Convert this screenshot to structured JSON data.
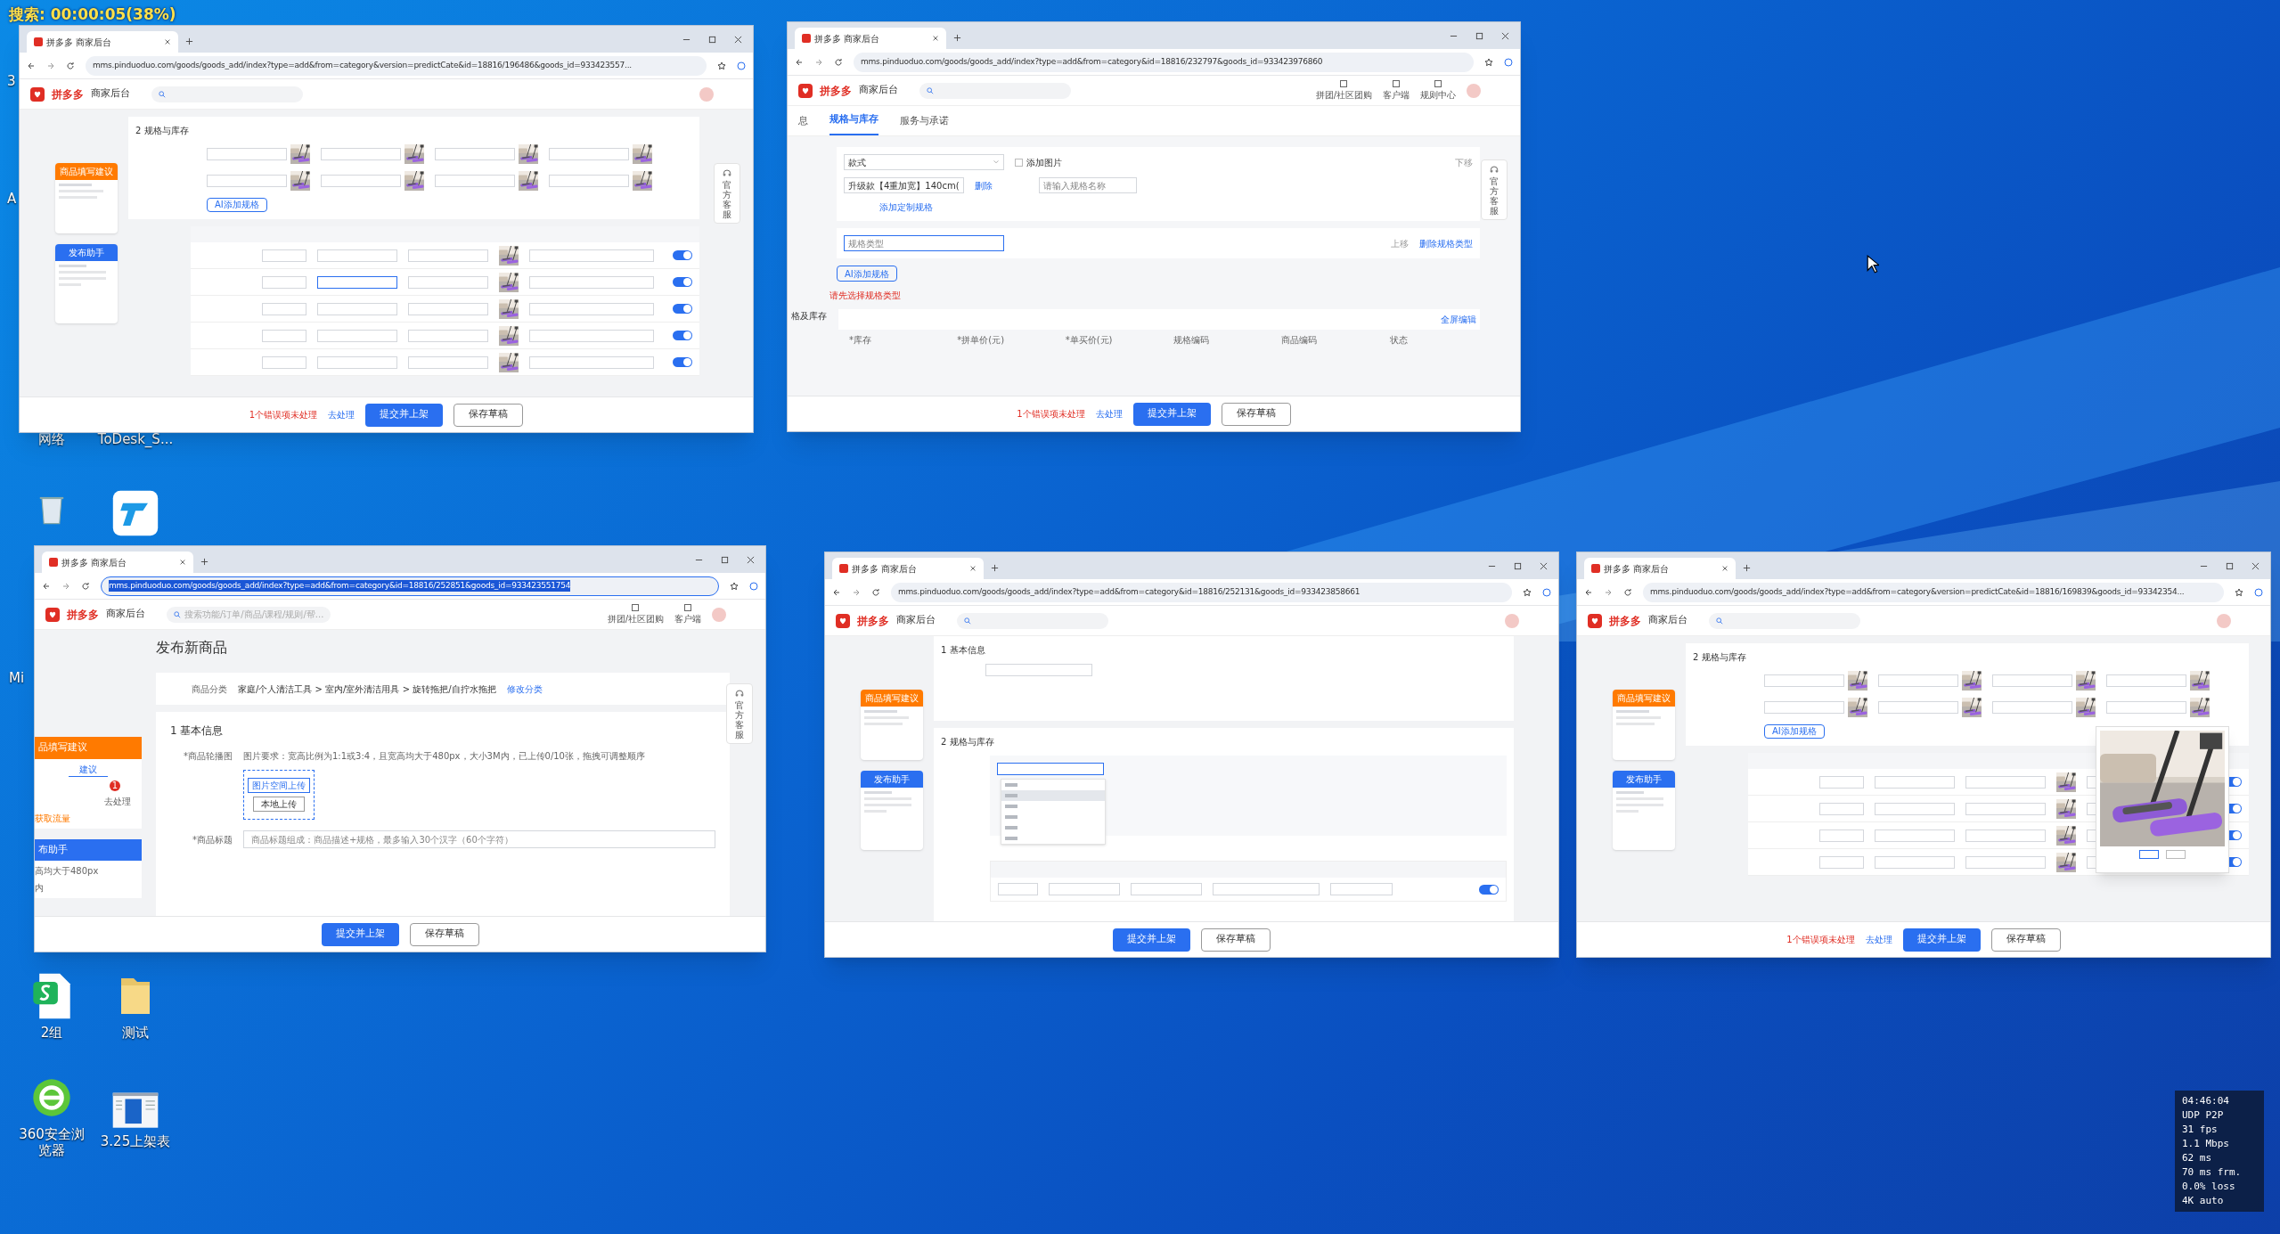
{
  "recording_label": "搜索: 00:00:05(38%)",
  "desktop_icons": [
    {
      "kind": "label_only",
      "label": "网络"
    },
    {
      "kind": "label_only",
      "label": "ToDesk_S..."
    },
    {
      "kind": "recycle"
    },
    {
      "kind": "remote"
    },
    {
      "kind": "sheet",
      "label": "2组"
    },
    {
      "kind": "folder",
      "label": "测试"
    },
    {
      "kind": "browser",
      "label": "360安全浏览器"
    },
    {
      "kind": "document",
      "label": "3.25上架表"
    }
  ],
  "edge_fragments": [
    "3",
    "A",
    "Mi"
  ],
  "windows": [
    {
      "kind": "sku",
      "tab_title": "拼多多 商家后台",
      "url": "mms.pinduoduo.com/goods/goods_add/index?type=add&from=category&version=predictCate&id=18816/196486&goods_id=933423557...",
      "url_selected": false,
      "logo": "拼多多",
      "logo_sub": "商家后台",
      "sidebar": {
        "suggest": "商品填写建议",
        "helper": "发布助手"
      },
      "section": "2 规格与库存",
      "ai_button": "AI添加规格",
      "service": "官方客服",
      "rows": [
        {
          "on": true
        },
        {
          "on": true
        },
        {
          "on": true
        },
        {
          "on": true
        },
        {
          "on": true
        }
      ],
      "popup": false,
      "footer": {
        "error": "1个错误项未处理",
        "link": "去处理",
        "submit": "提交并上架",
        "draft": "保存草稿"
      }
    },
    {
      "kind": "spec_editor",
      "tab_title": "拼多多 商家后台",
      "url": "mms.pinduoduo.com/goods/goods_add/index?type=add&from=category&id=18816/232797&goods_id=933423976860",
      "url_selected": false,
      "logo": "拼多多",
      "logo_sub": "商家后台",
      "header_links": [
        "拼团/社区团购",
        "客户端",
        "规则中心"
      ],
      "tabs": [
        {
          "label": "息",
          "selected": false
        },
        {
          "label": "规格与库存",
          "selected": true
        },
        {
          "label": "服务与承诺",
          "selected": false
        }
      ],
      "spec_type": "款式",
      "image_check": {
        "label": "添加图片",
        "checked": false
      },
      "spec_value": "升级款【4重加宽】140cm(",
      "delete": "删除",
      "name_placeholder": "请输入规格名称",
      "add_link": "添加定制规格",
      "move_down": "下移",
      "type_placeholder": "规格类型",
      "move_up": "上移",
      "delete_type": "删除规格类型",
      "ai_button": "AI添加规格",
      "error": "请先选择规格类型",
      "side_label": "格及库存",
      "fullscreen": "全屏编辑",
      "columns": [
        "*库存",
        "*拼单价(元)",
        "*单买价(元)",
        "规格编码",
        "商品编码",
        "状态"
      ],
      "service": "官方客服",
      "footer": {
        "error": "1个错误项未处理",
        "link": "去处理",
        "submit": "提交并上架",
        "draft": "保存草稿"
      }
    },
    {
      "kind": "basic",
      "tab_title": "拼多多 商家后台",
      "url": "mms.pinduoduo.com/goods/goods_add/index?type=add&from=category&id=18816/252851&goods_id=933423551754",
      "url_selected": true,
      "logo": "拼多多",
      "logo_sub": "商家后台",
      "search_placeholder": "搜索功能/订单/商品/课程/规则/帮...",
      "header_links": [
        "拼团/社区团购",
        "客户端"
      ],
      "page_title": "发布新商品",
      "category_label": "商品分类",
      "category_path": "家庭/个人清洁工具 > 室内/室外清洁用具 > 旋转拖把/自拧水拖把",
      "category_link": "修改分类",
      "section": "1 基本信息",
      "gallery_label": "*商品轮播图",
      "gallery_hint": "图片要求：宽高比例为1:1或3:4，且宽高均大于480px，大小3M内，已上传0/10张，拖拽可调整顺序",
      "upload_space": "图片空间上传",
      "upload_local": "本地上传",
      "title_label": "*商品标题",
      "title_placeholder": "商品标题组成：商品描述+规格，最多输入30个汉字（60个字符）",
      "sidebar": {
        "suggest": "品填写建议",
        "tab": "建议",
        "badge": "1",
        "link": "去处理",
        "traffic": "获取流量",
        "helper": "布助手",
        "lines": [
          "高均大于480px",
          "内"
        ]
      },
      "service": "官方客服",
      "footer": {
        "submit": "提交并上架",
        "draft": "保存草稿"
      }
    },
    {
      "kind": "spec_dropdown",
      "tab_title": "拼多多 商家后台",
      "url": "mms.pinduoduo.com/goods/goods_add/index?type=add&from=category&id=18816/252131&goods_id=933423858661",
      "url_selected": false,
      "logo": "拼多多",
      "logo_sub": "商家后台",
      "sidebar": {
        "suggest": "商品填写建议",
        "helper": "发布助手"
      },
      "section_1": "1 基本信息",
      "section_2": "2 规格与库存",
      "options": [
        {
          "selected": false
        },
        {
          "selected": true
        },
        {
          "selected": false
        },
        {
          "selected": false
        },
        {
          "selected": false
        },
        {
          "selected": false
        }
      ],
      "rows": [
        {
          "on": true
        }
      ],
      "footer": {
        "submit": "提交并上架",
        "draft": "保存草稿"
      }
    },
    {
      "kind": "sku",
      "tab_title": "拼多多 商家后台",
      "url": "mms.pinduoduo.com/goods/goods_add/index?type=add&from=category&version=predictCate&id=18816/169839&goods_id=93342354...",
      "url_selected": false,
      "logo": "拼多多",
      "logo_sub": "商家后台",
      "sidebar": {
        "suggest": "商品填写建议",
        "helper": "发布助手"
      },
      "section": "2 规格与库存",
      "ai_button": "AI添加规格",
      "rows": [
        {
          "on": true
        },
        {
          "on": true
        },
        {
          "on": true
        },
        {
          "on": true
        }
      ],
      "popup": true,
      "footer": {
        "error": "1个错误项未处理",
        "link": "去处理",
        "submit": "提交并上架",
        "draft": "保存草稿"
      }
    }
  ],
  "stats": [
    "04:46:04",
    "UDP P2P",
    "31 fps",
    "1.1 Mbps",
    "62 ms",
    "70 ms frm.",
    "0.0% loss",
    "4K auto"
  ]
}
